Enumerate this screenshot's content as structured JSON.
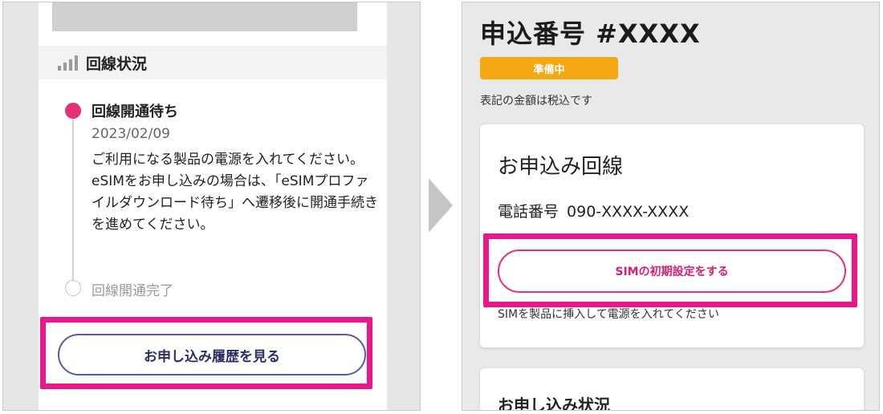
{
  "left": {
    "section_title": "回線状況",
    "timeline": [
      {
        "title": "回線開通待ち",
        "date": "2023/02/09",
        "description": "ご利用になる製品の電源を入れてください。eSIMをお申し込みの場合は、「eSIMプロファイルダウンロード待ち」へ遷移後に開通手続きを進めてください。"
      },
      {
        "title": "回線開通完了"
      }
    ],
    "history_button": "お申し込み履歴を見る"
  },
  "right": {
    "title": "申込番号 #XXXX",
    "status_badge": "準備中",
    "tax_note": "表記の金額は税込です",
    "line_card": {
      "title": "お申込み回線",
      "phone_label": "電話番号",
      "phone_value": "090-XXXX-XXXX",
      "sim_button": "SIMの初期設定をする",
      "sim_note": "SIMを製品に挿入して電源を入れてください"
    },
    "status_card": {
      "title": "お申し込み状況"
    }
  },
  "colors": {
    "highlight": "#e8188c",
    "accent_pink": "#e6307a",
    "badge_orange": "#f4a812",
    "button_border_navy": "#5a5aa0"
  },
  "icons": {
    "signal": "signal-bars-icon",
    "arrow": "arrow-right-icon"
  }
}
